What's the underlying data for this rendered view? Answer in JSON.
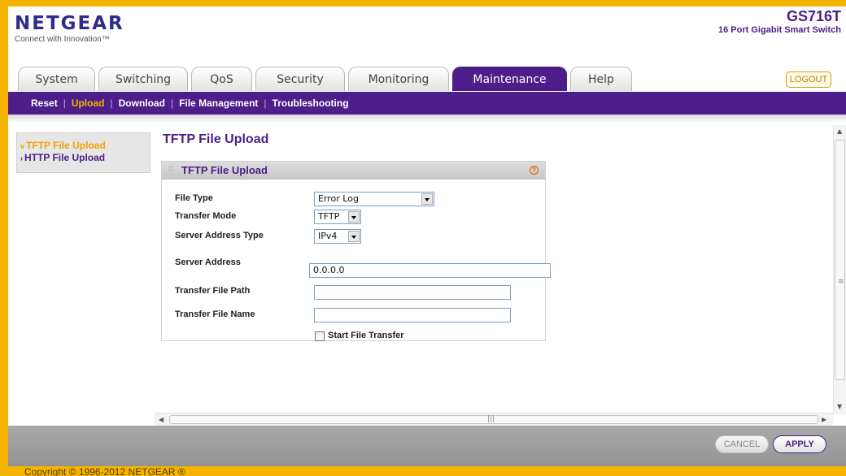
{
  "header": {
    "logo": "NETGEAR",
    "tagline": "Connect with Innovation™",
    "model": "GS716T",
    "model_desc": "16 Port Gigabit Smart Switch",
    "logout": "LOGOUT"
  },
  "tabs": [
    {
      "label": "System"
    },
    {
      "label": "Switching"
    },
    {
      "label": "QoS"
    },
    {
      "label": "Security"
    },
    {
      "label": "Monitoring"
    },
    {
      "label": "Maintenance",
      "active": true
    },
    {
      "label": "Help"
    }
  ],
  "subnav": [
    {
      "label": "Reset"
    },
    {
      "label": "Upload",
      "active": true
    },
    {
      "label": "Download"
    },
    {
      "label": "File Management"
    },
    {
      "label": "Troubleshooting"
    }
  ],
  "leftnav": [
    {
      "label": "TFTP File Upload",
      "active": true
    },
    {
      "label": "HTTP File Upload"
    }
  ],
  "main": {
    "page_title": "TFTP File Upload",
    "panel_title": "TFTP File Upload",
    "fields": {
      "file_type_label": "File Type",
      "file_type_value": "Error Log",
      "transfer_mode_label": "Transfer Mode",
      "transfer_mode_value": "TFTP",
      "server_address_type_label": "Server Address Type",
      "server_address_type_value": "IPv4",
      "server_address_label": "Server Address",
      "server_address_value": "0.0.0.0",
      "transfer_file_path_label": "Transfer File Path",
      "transfer_file_path_value": "",
      "transfer_file_name_label": "Transfer File Name",
      "transfer_file_name_value": "",
      "start_transfer_label": "Start File Transfer"
    }
  },
  "footer": {
    "cancel": "CANCEL",
    "apply": "APPLY",
    "copyright": "Copyright © 1996-2012 NETGEAR ®"
  },
  "icons": {
    "help": "help-icon",
    "dropdown": "chevron-down-icon"
  },
  "colors": {
    "brand_purple": "#4d1e8a",
    "accent_orange": "#f4b400"
  }
}
